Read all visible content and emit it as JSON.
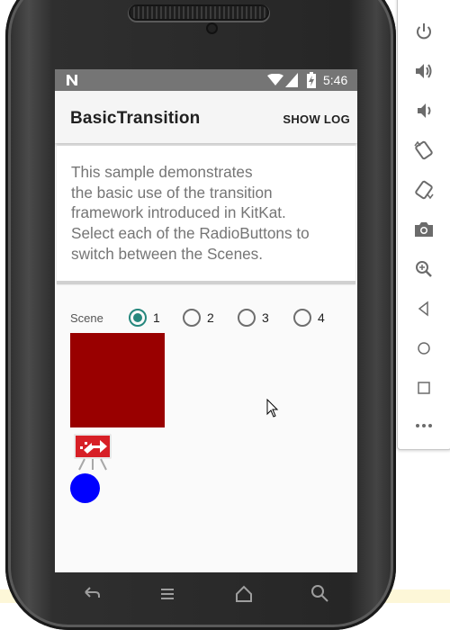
{
  "status_bar": {
    "time": "5:46"
  },
  "app_bar": {
    "title": "BasicTransition",
    "show_log_label": "SHOW LOG"
  },
  "description": {
    "lines": [
      "This sample demonstrates",
      "the basic use of the transition",
      "framework introduced in KitKat.",
      "Select each of the RadioButtons to",
      "switch between the Scenes."
    ]
  },
  "scene_selector": {
    "label": "Scene",
    "options": [
      {
        "label": "1",
        "checked": true
      },
      {
        "label": "2",
        "checked": false
      },
      {
        "label": "3",
        "checked": false
      },
      {
        "label": "4",
        "checked": false
      }
    ]
  },
  "scene_content": {
    "square_color": "#990000",
    "circle_color": "#0000ff"
  },
  "colors": {
    "accent": "#26877d",
    "status_bar": "#757575"
  },
  "side_toolbar": {
    "buttons": [
      "power-icon",
      "volume-up-icon",
      "volume-down-icon",
      "rotate-left-icon",
      "rotate-right-icon",
      "camera-icon",
      "zoom-icon",
      "back-icon",
      "home-icon",
      "overview-icon",
      "more-icon"
    ]
  },
  "nav_bar": {
    "buttons": [
      "back-icon",
      "menu-icon",
      "home-icon",
      "search-icon"
    ]
  }
}
